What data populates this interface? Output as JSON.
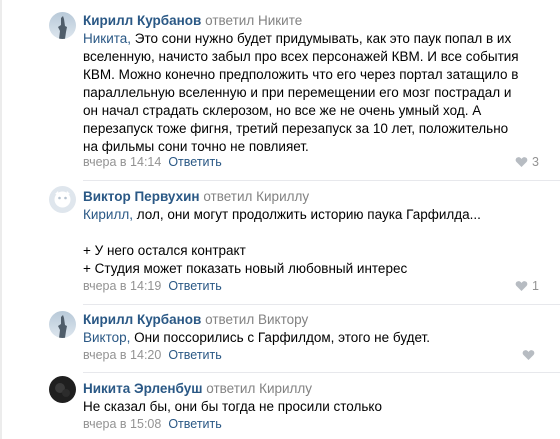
{
  "comments": [
    {
      "author": "Кирилл Курбанов",
      "replied": "ответил",
      "target": "Никите",
      "mention": "Никита,",
      "lines": [
        "Никита, Это сони нужно будет придумывать, как это паук попал в их",
        "вселенную, начисто забыл про всех персонажей КВМ. И все события",
        "КВМ. Можно конечно предположить что его через портал затащило в",
        "параллельную вселенную и при перемещении его мозг пострадал и",
        "он начал страдать склерозом, но все же не очень умный ход. А",
        "перезапуск тоже фигня, третий перезапуск за 10 лет, положительно",
        "на фильмы сони точно не повлияет."
      ],
      "date": "вчера в 14:14",
      "reply": "Ответить",
      "likes": "3",
      "avatar": "statue-avatar"
    },
    {
      "author": "Виктор Первухин",
      "replied": "ответил",
      "target": "Кириллу",
      "mention": "Кирилл,",
      "lines": [
        "Кирилл, лол, они могут продолжить историю паука Гарфилда...",
        "",
        "+ У него остался контракт",
        "+ Студия может показать новый любовный интерес"
      ],
      "date": "вчера в 14:19",
      "reply": "Ответить",
      "likes": "1",
      "avatar": "default-avatar"
    },
    {
      "author": "Кирилл Курбанов",
      "replied": "ответил",
      "target": "Виктору",
      "mention": "Виктор,",
      "lines": [
        "Виктор, Они поссорились с Гарфилдом, этого не будет."
      ],
      "date": "вчера в 14:20",
      "reply": "Ответить",
      "likes": "",
      "avatar": "statue-avatar"
    },
    {
      "author": "Никита Эрленбуш",
      "replied": "ответил",
      "target": "Кириллу",
      "mention": "",
      "lines": [
        "Не сказал бы, они бы тогда не просили столько"
      ],
      "date": "вчера в 15:08",
      "reply": "Ответить",
      "likes": "",
      "avatar": "dark-photo-avatar"
    }
  ],
  "colors": {
    "link": "#2a5885",
    "muted": "#828282",
    "divider": "#e7e8ec"
  }
}
